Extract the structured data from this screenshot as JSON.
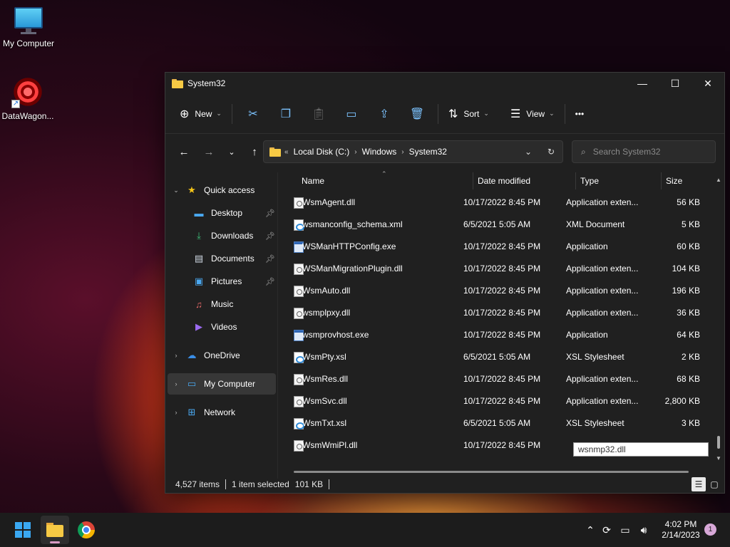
{
  "desktop": {
    "icons": [
      {
        "label": "My Computer",
        "icon": "monitor-icon"
      },
      {
        "label": "DataWagon...",
        "icon": "datawagon-icon"
      }
    ]
  },
  "window": {
    "title": "System32",
    "controls": {
      "minimize": "—",
      "maximize": "☐",
      "close": "✕"
    },
    "toolbar": {
      "new_label": "New",
      "sort_label": "Sort",
      "view_label": "View",
      "more_label": "•••"
    },
    "address": {
      "prefix": "«",
      "crumbs": [
        "Local Disk (C:)",
        "Windows",
        "System32"
      ]
    },
    "search": {
      "placeholder": "Search System32"
    },
    "sidebar": {
      "quick_access": "Quick access",
      "items": [
        {
          "label": "Desktop",
          "icon": "desktop-icon",
          "pinned": true
        },
        {
          "label": "Downloads",
          "icon": "download-icon",
          "pinned": true
        },
        {
          "label": "Documents",
          "icon": "documents-icon",
          "pinned": true
        },
        {
          "label": "Pictures",
          "icon": "pictures-icon",
          "pinned": true
        },
        {
          "label": "Music",
          "icon": "music-icon",
          "pinned": false
        },
        {
          "label": "Videos",
          "icon": "videos-icon",
          "pinned": false
        }
      ],
      "onedrive": "OneDrive",
      "my_computer": "My Computer",
      "network": "Network"
    },
    "columns": {
      "name": "Name",
      "date": "Date modified",
      "type": "Type",
      "size": "Size"
    },
    "files": [
      {
        "name": "WsmAgent.dll",
        "date": "10/17/2022 8:45 PM",
        "type": "Application exten...",
        "size": "56 KB",
        "kind": "dll"
      },
      {
        "name": "wsmanconfig_schema.xml",
        "date": "6/5/2021 5:05 AM",
        "type": "XML Document",
        "size": "5 KB",
        "kind": "xml"
      },
      {
        "name": "WSManHTTPConfig.exe",
        "date": "10/17/2022 8:45 PM",
        "type": "Application",
        "size": "60 KB",
        "kind": "exe"
      },
      {
        "name": "WSManMigrationPlugin.dll",
        "date": "10/17/2022 8:45 PM",
        "type": "Application exten...",
        "size": "104 KB",
        "kind": "dll"
      },
      {
        "name": "WsmAuto.dll",
        "date": "10/17/2022 8:45 PM",
        "type": "Application exten...",
        "size": "196 KB",
        "kind": "dll"
      },
      {
        "name": "wsmplpxy.dll",
        "date": "10/17/2022 8:45 PM",
        "type": "Application exten...",
        "size": "36 KB",
        "kind": "dll"
      },
      {
        "name": "wsmprovhost.exe",
        "date": "10/17/2022 8:45 PM",
        "type": "Application",
        "size": "64 KB",
        "kind": "exe"
      },
      {
        "name": "WsmPty.xsl",
        "date": "6/5/2021 5:05 AM",
        "type": "XSL Stylesheet",
        "size": "2 KB",
        "kind": "xml"
      },
      {
        "name": "WsmRes.dll",
        "date": "10/17/2022 8:45 PM",
        "type": "Application exten...",
        "size": "68 KB",
        "kind": "dll"
      },
      {
        "name": "WsmSvc.dll",
        "date": "10/17/2022 8:45 PM",
        "type": "Application exten...",
        "size": "2,800 KB",
        "kind": "dll"
      },
      {
        "name": "WsmTxt.xsl",
        "date": "6/5/2021 5:05 AM",
        "type": "XSL Stylesheet",
        "size": "3 KB",
        "kind": "xml"
      },
      {
        "name": "WsmWmiPl.dll",
        "date": "10/17/2022 8:45 PM",
        "type": "",
        "size": "",
        "kind": "dll"
      }
    ],
    "tooltip": "wsnmp32.dll",
    "status": {
      "count": "4,527 items",
      "selected": "1 item selected",
      "size": "101 KB"
    }
  },
  "taskbar": {
    "time": "4:02 PM",
    "date": "2/14/2023",
    "notifications": "1"
  }
}
